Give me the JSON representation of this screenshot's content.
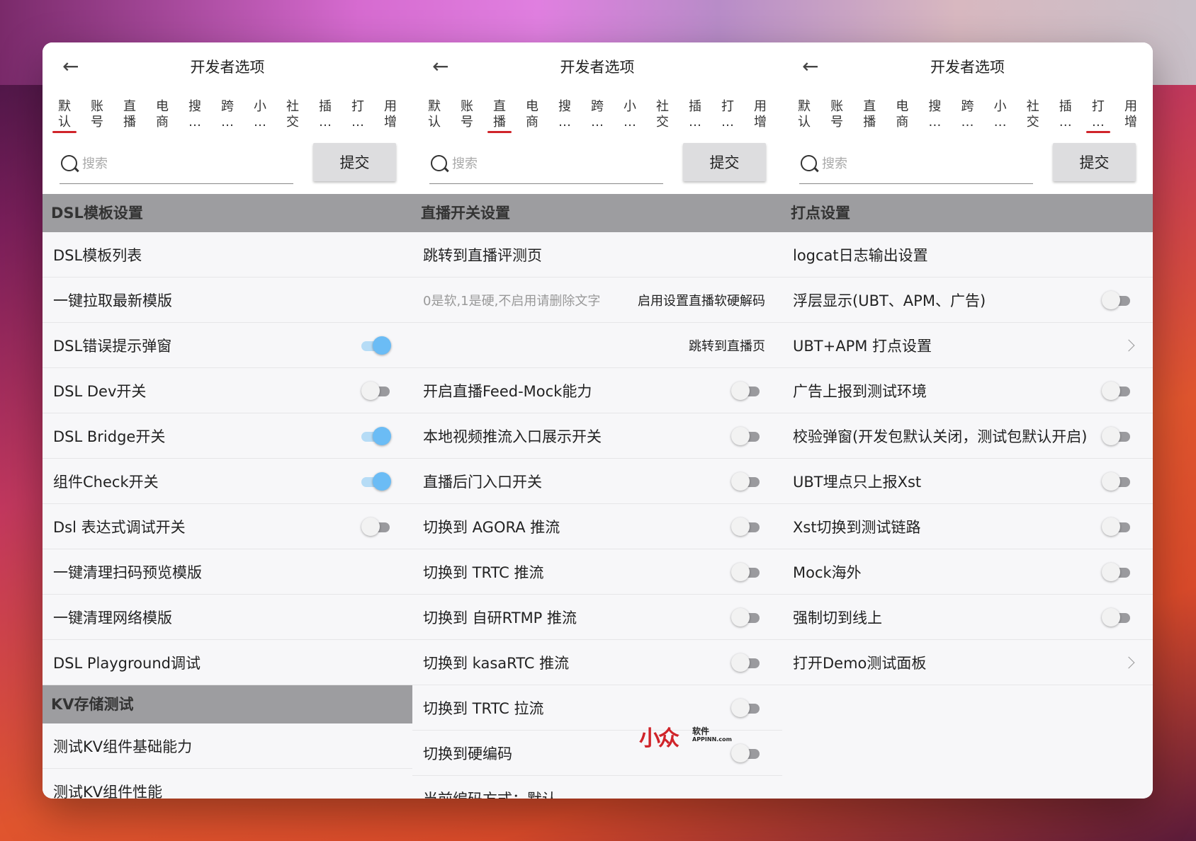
{
  "panes": [
    {
      "title": "开发者选项",
      "active_tab": 0,
      "search_placeholder": "搜索",
      "submit_label": "提交",
      "sections": [
        {
          "name": "DSL模板设置"
        },
        {
          "name": "KV存储测试"
        }
      ],
      "rows": [
        {
          "label": "DSL模板列表",
          "control": "none"
        },
        {
          "label": "一键拉取最新模版",
          "control": "none"
        },
        {
          "label": "DSL错误提示弹窗",
          "control": "toggle",
          "on": true
        },
        {
          "label": "DSL Dev开关",
          "control": "toggle",
          "on": false
        },
        {
          "label": "DSL Bridge开关",
          "control": "toggle",
          "on": true
        },
        {
          "label": "组件Check开关",
          "control": "toggle",
          "on": true
        },
        {
          "label": "Dsl 表达式调试开关",
          "control": "toggle",
          "on": false
        },
        {
          "label": "一键清理扫码预览模版",
          "control": "none"
        },
        {
          "label": "一键清理网络模版",
          "control": "none"
        },
        {
          "label": "DSL Playground调试",
          "control": "none"
        },
        {
          "label": "测试KV组件基础能力",
          "control": "none"
        },
        {
          "label": "测试KV组件性能",
          "control": "none"
        }
      ]
    },
    {
      "title": "开发者选项",
      "active_tab": 2,
      "search_placeholder": "搜索",
      "submit_label": "提交",
      "section": "直播开关设置",
      "rows": [
        {
          "label": "跳转到直播评测页",
          "control": "none"
        },
        {
          "label": "0是软,1是硬,不启用请删除文字",
          "control": "input",
          "button": "启用设置直播软硬解码"
        },
        {
          "label": "",
          "control": "link",
          "button": "跳转到直播页"
        },
        {
          "label": "开启直播Feed-Mock能力",
          "control": "toggle",
          "on": false
        },
        {
          "label": "本地视频推流入口展示开关",
          "control": "toggle",
          "on": false
        },
        {
          "label": "直播后门入口开关",
          "control": "toggle",
          "on": false
        },
        {
          "label": "切换到 AGORA 推流",
          "control": "toggle",
          "on": false
        },
        {
          "label": "切换到 TRTC 推流",
          "control": "toggle",
          "on": false
        },
        {
          "label": "切换到 自研RTMP 推流",
          "control": "toggle",
          "on": false
        },
        {
          "label": "切换到 kasaRTC 推流",
          "control": "toggle",
          "on": false
        },
        {
          "label": "切换到 TRTC 拉流",
          "control": "toggle",
          "on": false
        },
        {
          "label": "切换到硬编码",
          "control": "toggle",
          "on": false
        },
        {
          "label": "当前编码方式：默认",
          "control": "none"
        }
      ]
    },
    {
      "title": "开发者选项",
      "active_tab": 9,
      "search_placeholder": "搜索",
      "submit_label": "提交",
      "section": "打点设置",
      "rows": [
        {
          "label": "logcat日志输出设置",
          "control": "none"
        },
        {
          "label": "浮层显示(UBT、APM、广告)",
          "control": "toggle",
          "on": false
        },
        {
          "label": "UBT+APM 打点设置",
          "control": "chevron"
        },
        {
          "label": "广告上报到测试环境",
          "control": "toggle",
          "on": false
        },
        {
          "label": "校验弹窗(开发包默认关闭，测试包默认开启)",
          "control": "toggle",
          "on": false
        },
        {
          "label": "UBT埋点只上报Xst",
          "control": "toggle",
          "on": false
        },
        {
          "label": "Xst切换到测试链路",
          "control": "toggle",
          "on": false
        },
        {
          "label": "Mock海外",
          "control": "toggle",
          "on": false
        },
        {
          "label": "强制切到线上",
          "control": "toggle",
          "on": false
        },
        {
          "label": "打开Demo测试面板",
          "control": "chevron"
        }
      ]
    }
  ],
  "tabs": [
    [
      "默",
      "认"
    ],
    [
      "账",
      "号"
    ],
    [
      "直",
      "播"
    ],
    [
      "电",
      "商"
    ],
    [
      "搜",
      "…"
    ],
    [
      "跨",
      "…"
    ],
    [
      "小",
      "…"
    ],
    [
      "社",
      "交"
    ],
    [
      "插",
      "…"
    ],
    [
      "打",
      "…"
    ],
    [
      "用",
      "增"
    ]
  ],
  "watermark": {
    "mark": "小众",
    "text": "软件",
    "url": "APPINN.com"
  },
  "colors": {
    "accent": "#d0242a",
    "toggle_on": "#6bbcf5",
    "section_bg": "#9d9da0"
  }
}
